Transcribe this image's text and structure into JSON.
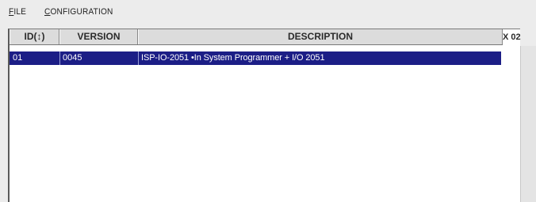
{
  "menu": {
    "file": {
      "accel": "F",
      "rest": "ILE"
    },
    "configuration": {
      "accel": "C",
      "rest": "ONFIGURATION"
    }
  },
  "table": {
    "columns": {
      "id": "ID(↕)",
      "version": "VERSION",
      "description": "DESCRIPTION"
    },
    "rows": [
      {
        "id": "01",
        "version": "0045",
        "description": "ISP-IO-2051 •In System Programmer + I/O 2051",
        "selected": true
      }
    ],
    "count_label": "X 02"
  },
  "colors": {
    "selection": "#1c1e86",
    "header_bg": "#dcdcdc",
    "window_bg": "#ececec"
  }
}
